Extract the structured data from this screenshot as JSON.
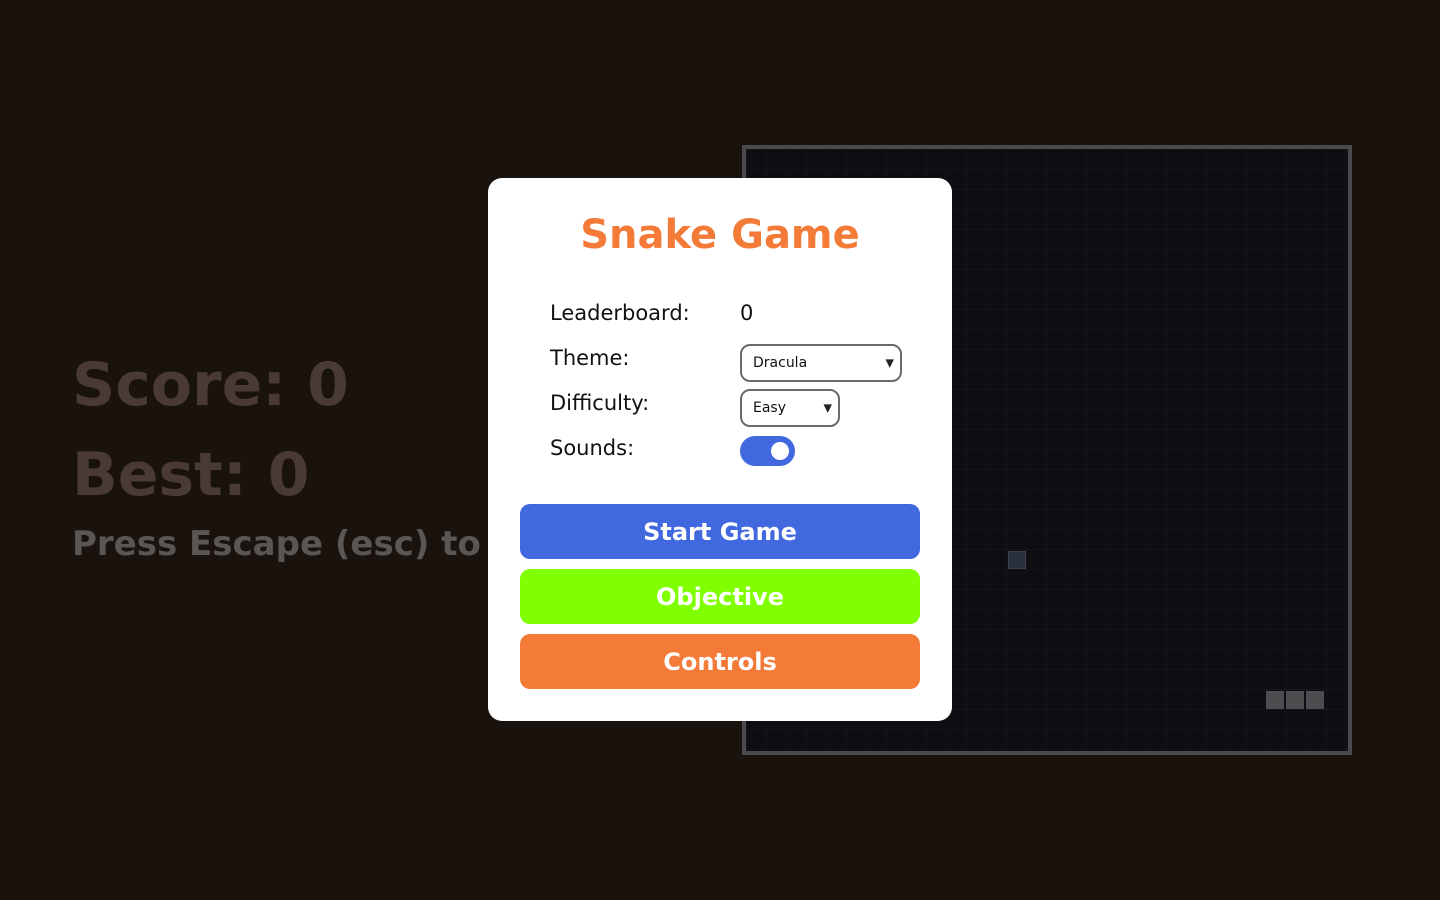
{
  "hud": {
    "score_text": "Score: 0",
    "best_text": "Best: 0",
    "hint_text": "Press Escape (esc) to pause"
  },
  "modal": {
    "title": "Snake Game",
    "leaderboard_label": "Leaderboard:",
    "leaderboard_value": "0",
    "theme_label": "Theme:",
    "theme_selected": "Dracula",
    "difficulty_label": "Difficulty:",
    "difficulty_selected": "Easy",
    "sounds_label": "Sounds:",
    "sounds_enabled": true,
    "start_button": "Start Game",
    "objective_button": "Objective",
    "controls_button": "Controls"
  },
  "colors": {
    "background": "#1a120d",
    "title": "#f47a37",
    "start_button": "#4268e0",
    "objective_button": "#7fff00",
    "controls_button": "#f47a37",
    "toggle_on": "#4268e0"
  },
  "icons": {
    "select_chevron": "chevron-down-icon"
  }
}
